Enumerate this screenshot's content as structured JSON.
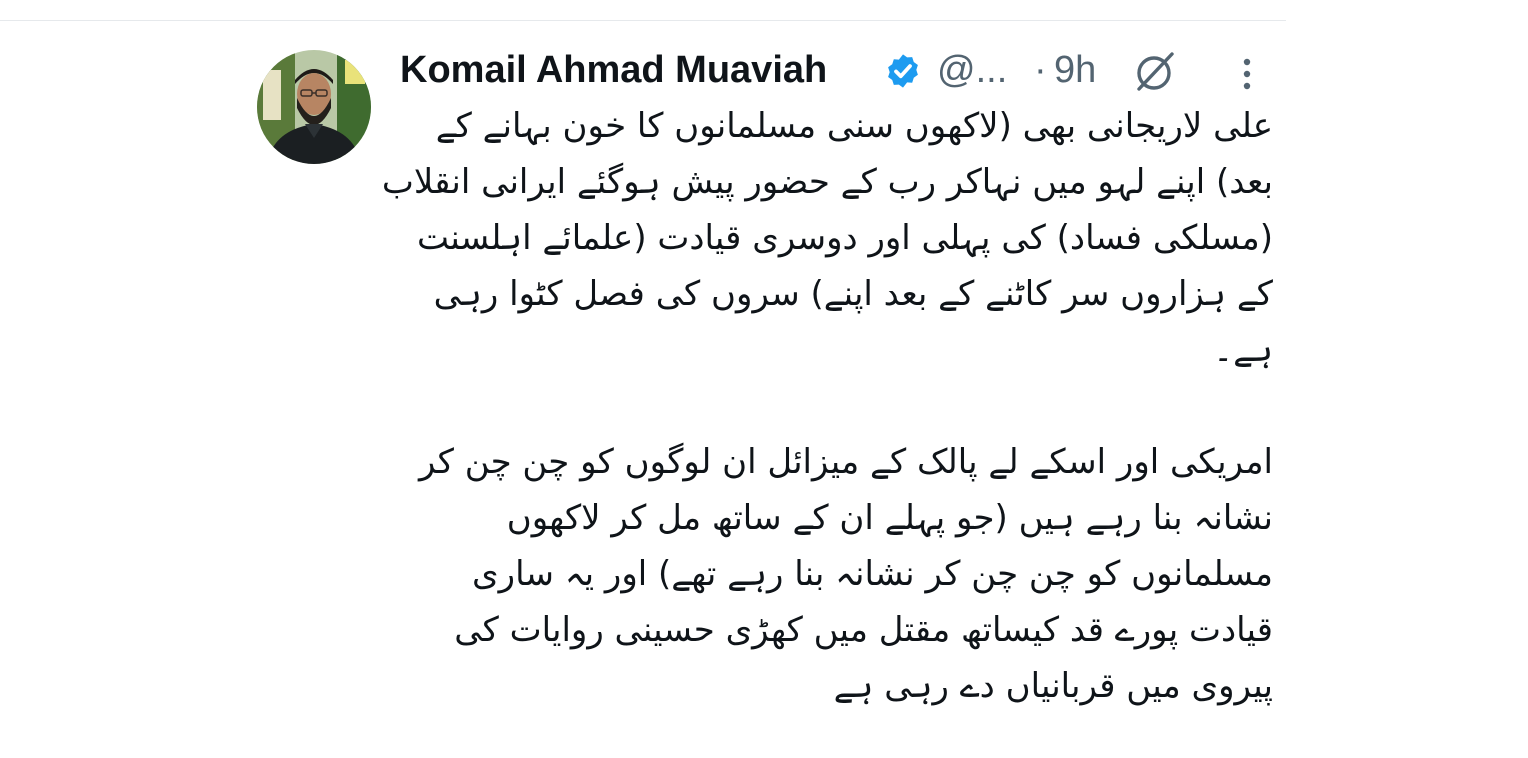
{
  "author": {
    "display_name": "Komail Ahmad Muaviah",
    "handle": "@...",
    "time_separator": "·",
    "time": "9h",
    "verified": true
  },
  "icons": {
    "verified": "verified-badge-icon",
    "grok": "grok-icon",
    "more": "more-vertical-icon"
  },
  "colors": {
    "text": "#0f1419",
    "muted": "#536471",
    "verified_badge": "#1d9bf0",
    "divider": "#e6e9ec"
  },
  "tweet": {
    "paragraph_1": "علی لاریجانی بھی (لاکھوں سنی مسلمانوں کا خون بہانے کے بعد) اپنے لہو میں نہاکر رب کے حضور پیش ہوگئے ایرانی انقلاب (مسلکی فساد) کی پہلی اور دوسری قیادت (علمائے اہلسنت کے ہزاروں سر کاٹنے کے بعد اپنے) سروں کی فصل کٹوا رہی ہے۔",
    "paragraph_2": "امریکی اور اسکے لے پالک کے میزائل ان لوگوں کو چن چن کر نشانہ بنا رہے ہیں (جو پہلے ان کے ساتھ مل کر لاکھوں مسلمانوں کو چن چن کر نشانہ بنا رہے تھے) اور یہ ساری قیادت پورے قد کیساتھ مقتل میں کھڑی حسینی روایات کی پیروی میں قربانیاں دے رہی ہے"
  }
}
